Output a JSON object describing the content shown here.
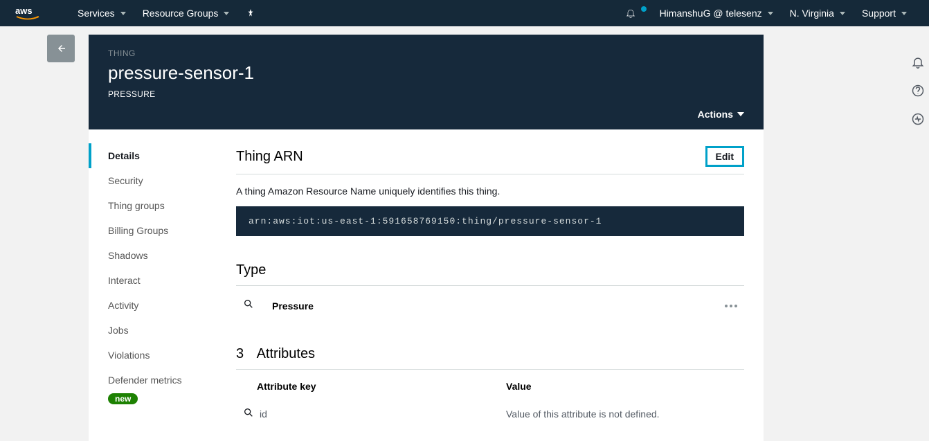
{
  "topnav": {
    "services": "Services",
    "resource_groups": "Resource Groups",
    "user": "HimanshuG @ telesenz",
    "region": "N. Virginia",
    "support": "Support"
  },
  "hero": {
    "breadcrumb": "THING",
    "title": "pressure-sensor-1",
    "type": "PRESSURE",
    "actions": "Actions"
  },
  "sidebar": {
    "items": [
      {
        "label": "Details"
      },
      {
        "label": "Security"
      },
      {
        "label": "Thing groups"
      },
      {
        "label": "Billing Groups"
      },
      {
        "label": "Shadows"
      },
      {
        "label": "Interact"
      },
      {
        "label": "Activity"
      },
      {
        "label": "Jobs"
      },
      {
        "label": "Violations"
      },
      {
        "label": "Defender metrics"
      }
    ],
    "new_badge": "new"
  },
  "arn_section": {
    "title": "Thing ARN",
    "edit": "Edit",
    "description": "A thing Amazon Resource Name uniquely identifies this thing.",
    "arn": "arn:aws:iot:us-east-1:591658769150:thing/pressure-sensor-1"
  },
  "type_section": {
    "title": "Type",
    "value": "Pressure"
  },
  "attributes": {
    "count": "3",
    "title": "Attributes",
    "col_key": "Attribute key",
    "col_value": "Value",
    "rows": [
      {
        "key": "id",
        "value": "Value of this attribute is not defined."
      }
    ]
  }
}
